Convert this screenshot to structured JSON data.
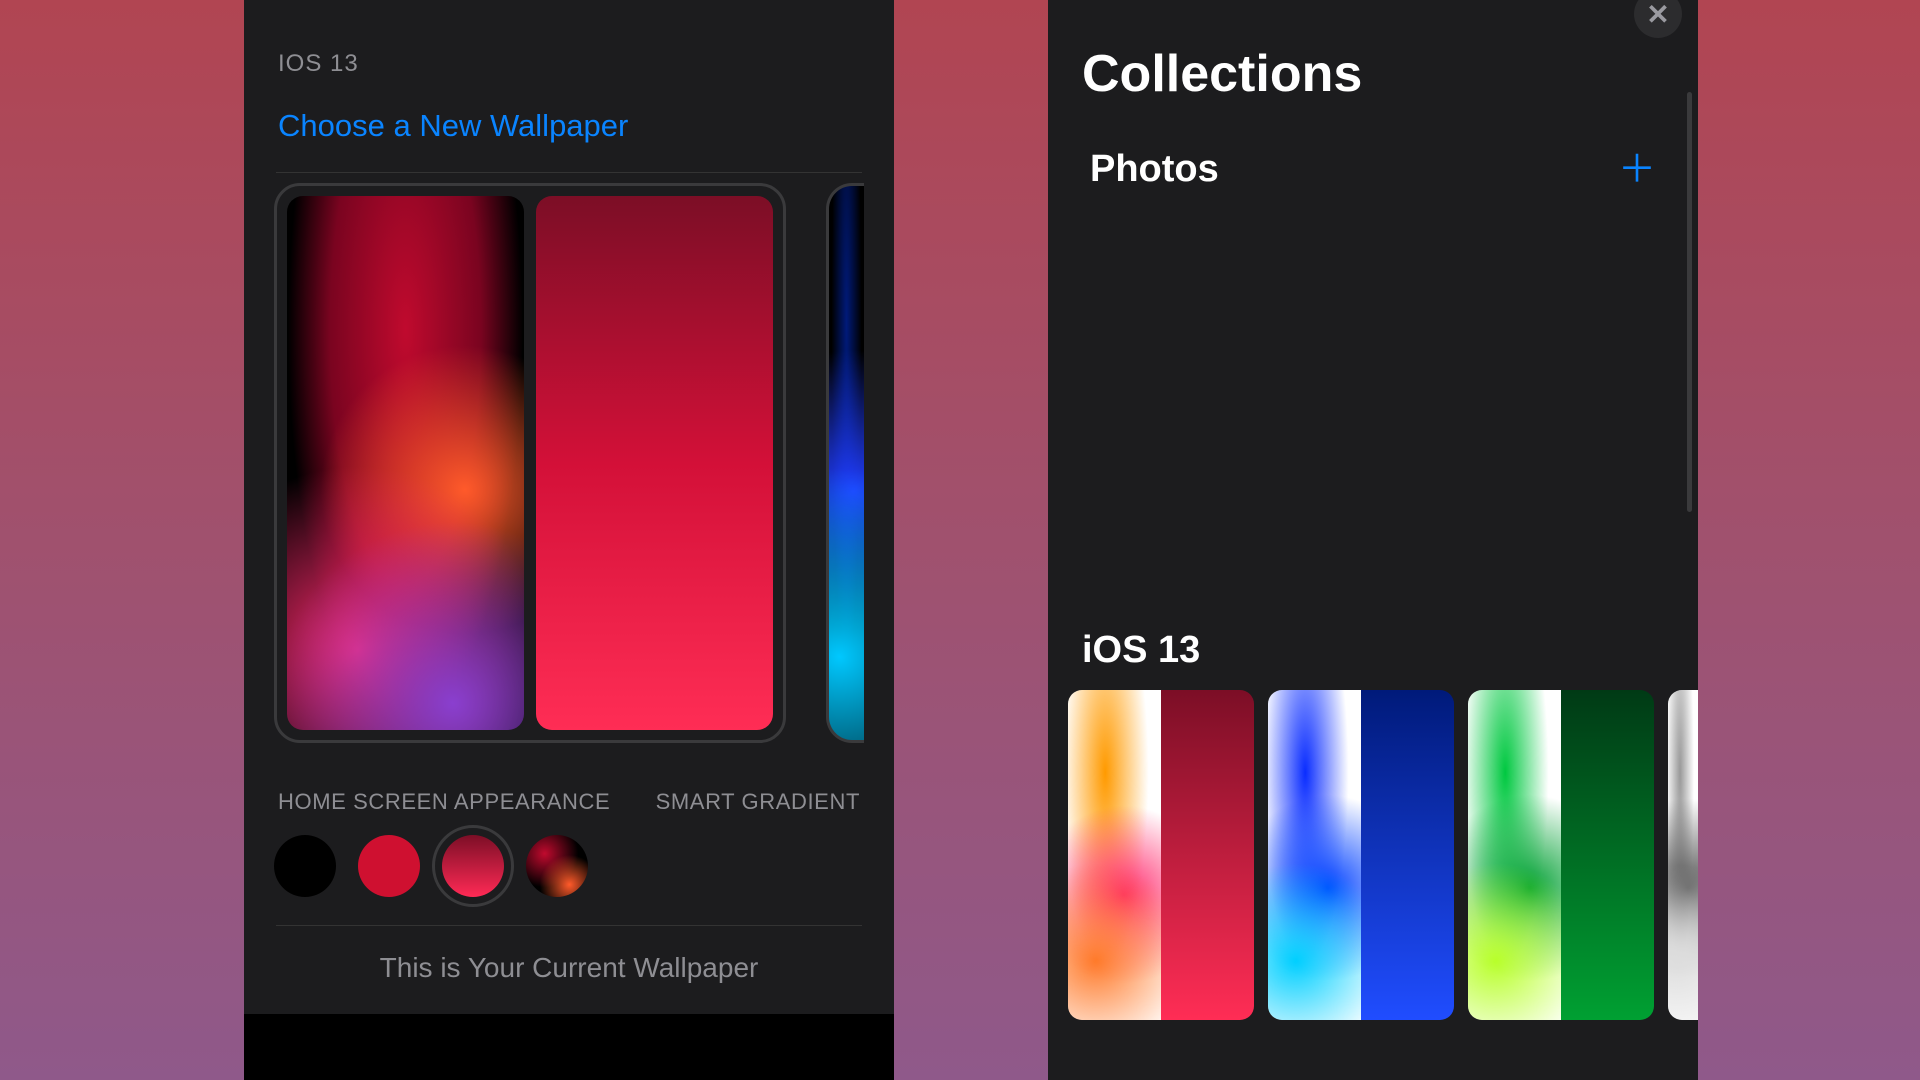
{
  "left": {
    "section_caption": "IOS 13",
    "choose_label": "Choose a New Wallpaper",
    "appearance_label": "HOME SCREEN APPEARANCE",
    "smart_gradient_label": "SMART GRADIENT",
    "current_label": "This is Your Current Wallpaper",
    "swatches": [
      "black",
      "red-solid",
      "red-gradient",
      "wallpaper-match"
    ],
    "selected_swatch_index": 2
  },
  "right": {
    "close": "✕",
    "title": "Collections",
    "photos_label": "Photos",
    "plus": "＋",
    "section_label": "iOS 13",
    "thumbs": [
      "red",
      "blue",
      "green",
      "grey"
    ]
  }
}
